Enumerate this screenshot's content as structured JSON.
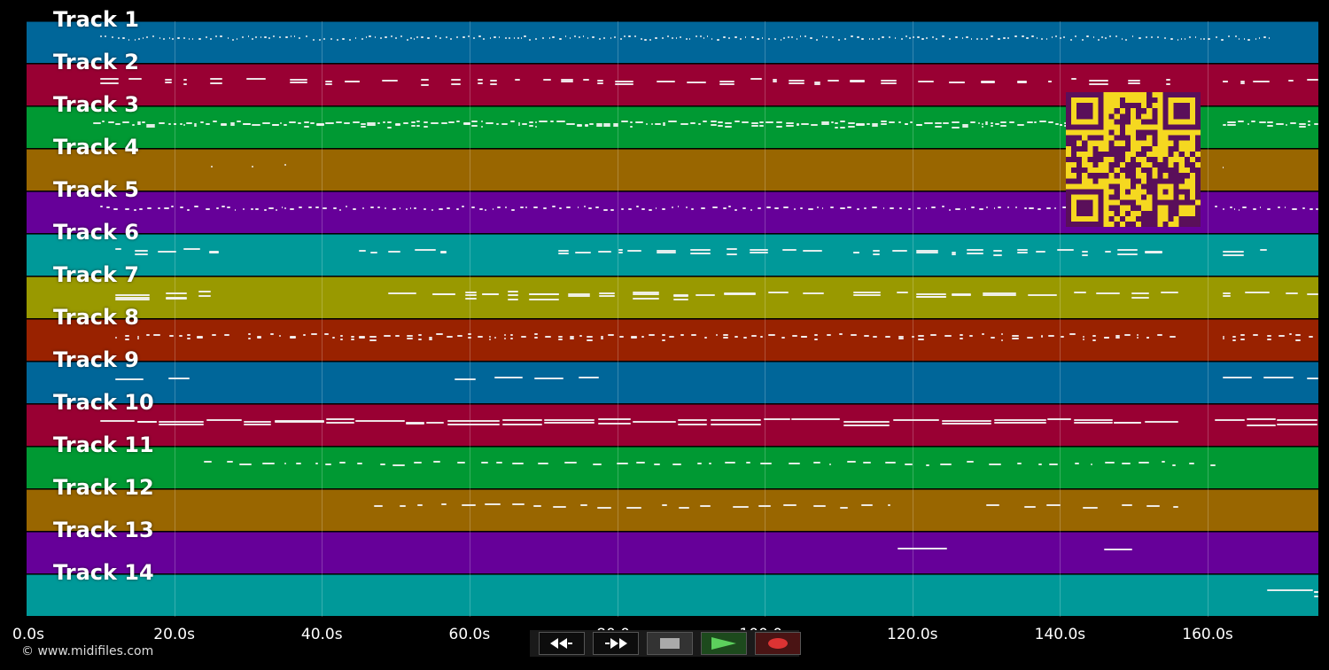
{
  "tracks": [
    {
      "label": "Track 1",
      "color": "#006699"
    },
    {
      "label": "Track 2",
      "color": "#990033"
    },
    {
      "label": "Track 3",
      "color": "#009933"
    },
    {
      "label": "Track 4",
      "color": "#996600"
    },
    {
      "label": "Track 5",
      "color": "#660099"
    },
    {
      "label": "Track 6",
      "color": "#009999"
    },
    {
      "label": "Track 7",
      "color": "#999900"
    },
    {
      "label": "Track 8",
      "color": "#992200"
    },
    {
      "label": "Track 9",
      "color": "#006699"
    },
    {
      "label": "Track 10",
      "color": "#990033"
    },
    {
      "label": "Track 11",
      "color": "#009933"
    },
    {
      "label": "Track 12",
      "color": "#996600"
    },
    {
      "label": "Track 13",
      "color": "#660099"
    },
    {
      "label": "Track 14",
      "color": "#009999"
    }
  ],
  "timeline": {
    "duration_s": 175,
    "ticks": [
      "0.0s",
      "20.0s",
      "40.0s",
      "60.0s",
      "80.0s",
      "100.0s",
      "120.0s",
      "140.0s",
      "160.0s"
    ]
  },
  "copyright": "© www.midifiles.com",
  "controls": [
    {
      "name": "rewind-button",
      "icon": "rewind-icon",
      "color": "#ffffff"
    },
    {
      "name": "fast-forward-button",
      "icon": "fast-forward-icon",
      "color": "#ffffff"
    },
    {
      "name": "stop-button",
      "icon": "stop-icon",
      "color": "#aaaaaa"
    },
    {
      "name": "play-button",
      "icon": "play-icon",
      "color": "#5cd05c"
    },
    {
      "name": "record-button",
      "icon": "record-icon",
      "color": "#dd3333"
    }
  ],
  "qr_code": {
    "icon": "qr-code-icon",
    "color": "#f5d820",
    "ink": "#5a0f5a"
  }
}
